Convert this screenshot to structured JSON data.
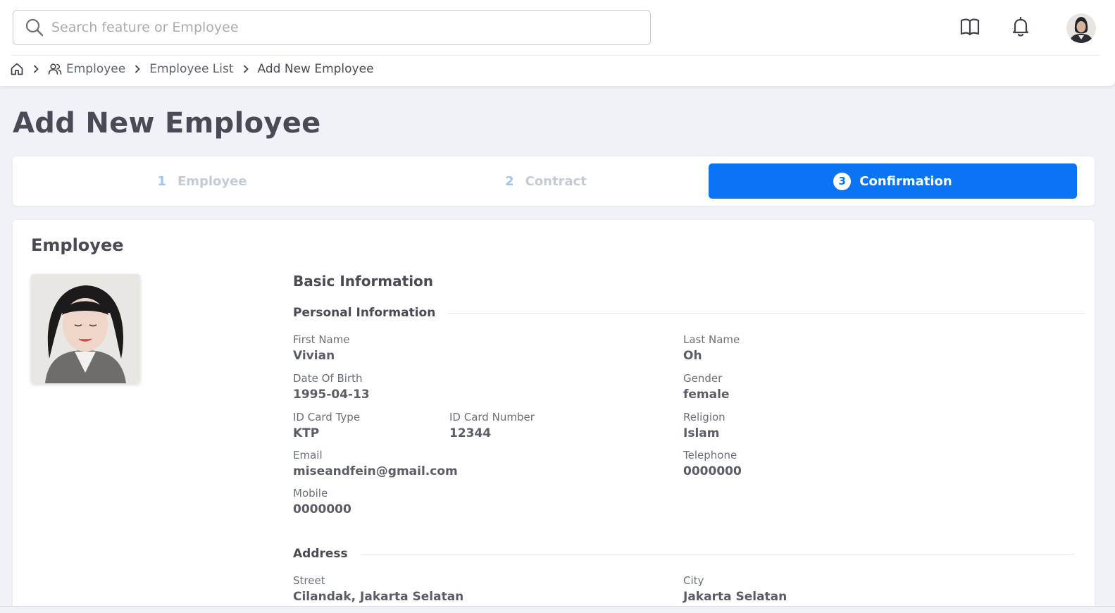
{
  "header": {
    "search_placeholder": "Search feature or Employee",
    "icons": [
      "search-icon",
      "book-icon",
      "bell-icon",
      "avatar"
    ]
  },
  "breadcrumb": {
    "items": [
      "Employee",
      "Employee List",
      "Add New Employee"
    ]
  },
  "page": {
    "title": "Add New Employee"
  },
  "stepper": {
    "steps": [
      {
        "num": "1",
        "label": "Employee",
        "state": "inactive"
      },
      {
        "num": "2",
        "label": "Contract",
        "state": "inactive"
      },
      {
        "num": "3",
        "label": "Confirmation",
        "state": "active"
      }
    ],
    "accent": "#0a74f5"
  },
  "employee": {
    "card_title": "Employee",
    "section_title": "Basic Information",
    "personal_heading": "Personal Information",
    "address_heading": "Address",
    "fields": {
      "first_name": {
        "label": "First Name",
        "value": "Vivian"
      },
      "last_name": {
        "label": "Last Name",
        "value": "Oh"
      },
      "dob": {
        "label": "Date Of Birth",
        "value": "1995-04-13"
      },
      "gender": {
        "label": "Gender",
        "value": "female"
      },
      "id_type": {
        "label": "ID Card Type",
        "value": "KTP"
      },
      "id_number": {
        "label": "ID Card Number",
        "value": "12344"
      },
      "religion": {
        "label": "Religion",
        "value": "Islam"
      },
      "email": {
        "label": "Email",
        "value": "miseandfein@gmail.com"
      },
      "telephone": {
        "label": "Telephone",
        "value": "0000000"
      },
      "mobile": {
        "label": "Mobile",
        "value": "0000000"
      },
      "street": {
        "label": "Street",
        "value": "Cilandak, Jakarta Selatan"
      },
      "city": {
        "label": "City",
        "value": "Jakarta Selatan"
      }
    }
  }
}
